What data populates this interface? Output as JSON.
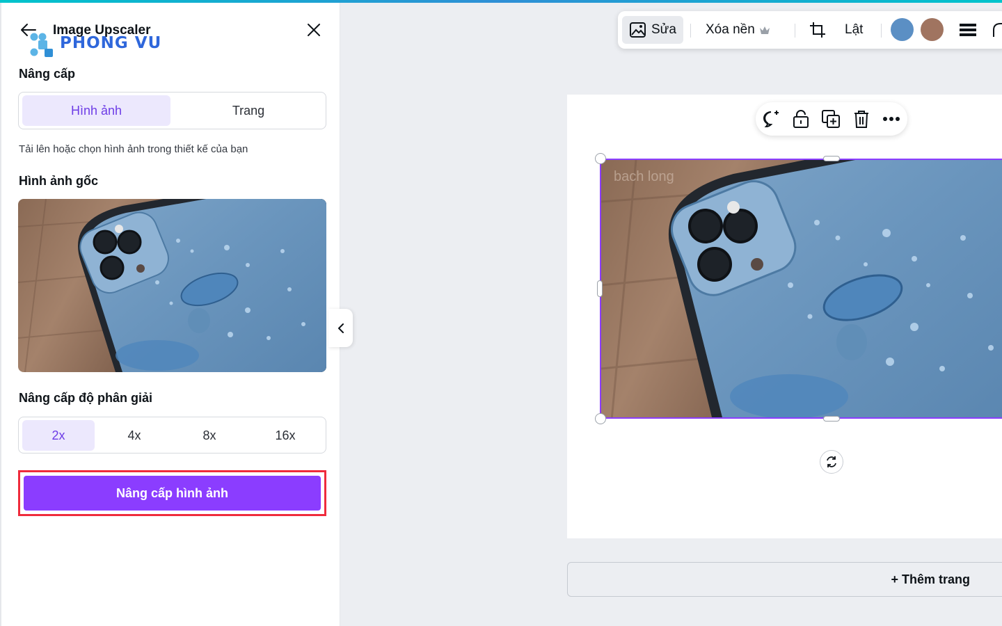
{
  "panel": {
    "title": "Image Upscaler",
    "watermark_text": "PHONG VU",
    "section_upscale": "Nâng cấp",
    "tabs": [
      {
        "label": "Hình ảnh",
        "active": true
      },
      {
        "label": "Trang",
        "active": false
      }
    ],
    "help_text": "Tải lên hoặc chọn hình ảnh trong thiết kế của bạn",
    "original_label": "Hình ảnh gốc",
    "resolution_label": "Nâng cấp độ phân giải",
    "scales": [
      {
        "label": "2x",
        "active": true
      },
      {
        "label": "4x",
        "active": false
      },
      {
        "label": "8x",
        "active": false
      },
      {
        "label": "16x",
        "active": false
      }
    ],
    "upscale_button": "Nâng cấp hình ảnh"
  },
  "toolbar": {
    "edit_label": "Sửa",
    "remove_bg_label": "Xóa nền",
    "flip_label": "Lật",
    "swatches": [
      "#5b8fc4",
      "#a07460"
    ]
  },
  "canvas": {
    "add_page_label": "+ Thêm trang",
    "image_watermark": "bach long"
  },
  "colors": {
    "accent": "#8b3dff",
    "highlight_border": "#ef2b3c",
    "tab_active_bg": "#ece8fd"
  }
}
